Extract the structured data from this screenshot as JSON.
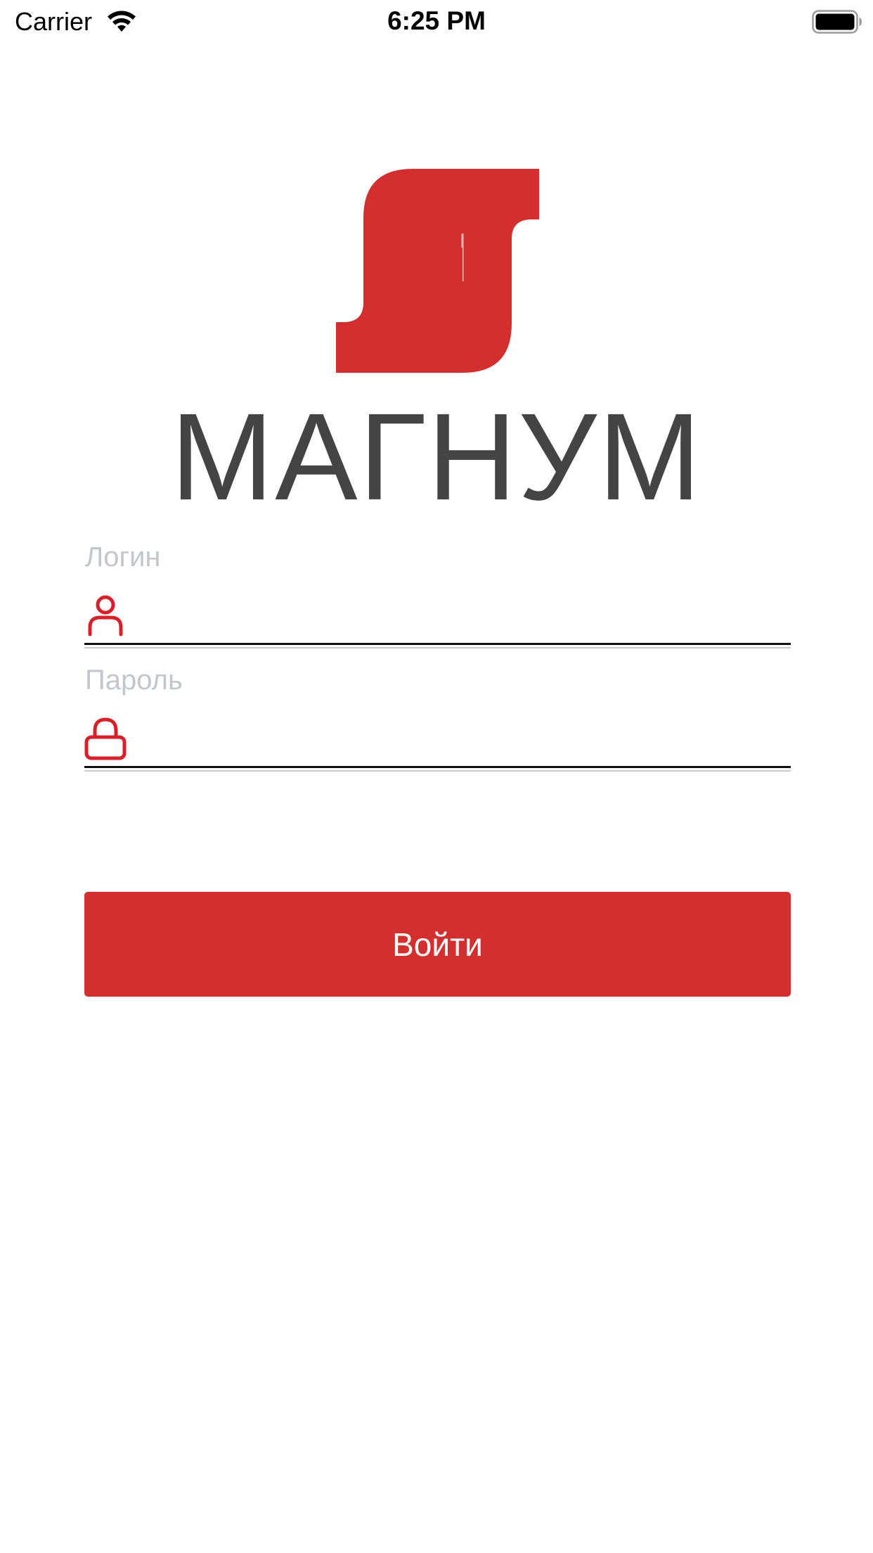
{
  "status_bar": {
    "carrier": "Carrier",
    "time": "6:25 PM",
    "wifi_icon": "wifi-icon",
    "battery_icon": "battery-icon"
  },
  "brand": {
    "name": "МАГНУМ",
    "logo_icon": "magnum-logo",
    "color": "#d32f2f"
  },
  "form": {
    "login": {
      "label": "Логин",
      "value": "",
      "icon": "user-icon"
    },
    "password": {
      "label": "Пароль",
      "value": "",
      "icon": "lock-icon"
    },
    "submit_label": "Войти"
  },
  "colors": {
    "accent": "#d32f2f",
    "label": "#c3c6cc",
    "title": "#444444"
  }
}
